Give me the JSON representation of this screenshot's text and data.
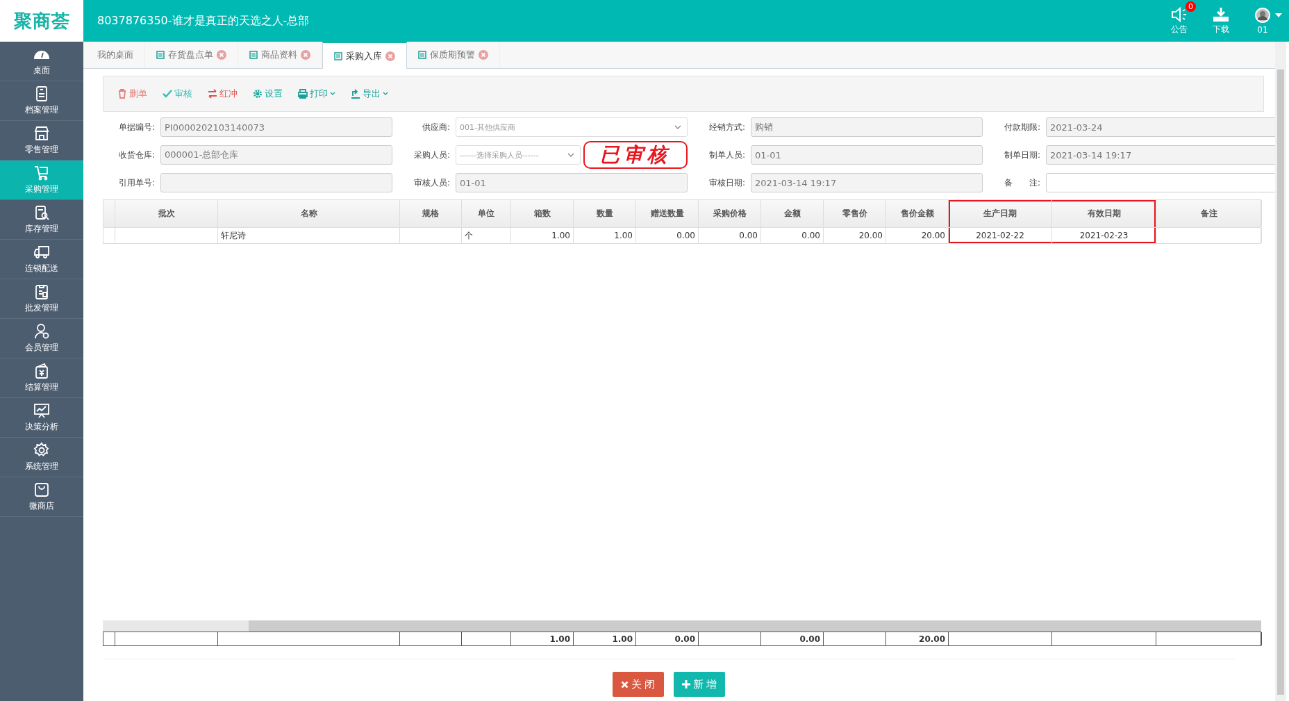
{
  "header": {
    "logo": "聚商荟",
    "title": "8037876350-谁才是真正的天选之人-总部",
    "notice": {
      "label": "公告",
      "badge": "0"
    },
    "download": {
      "label": "下载"
    },
    "user": {
      "label": "01"
    }
  },
  "sidebar": {
    "items": [
      {
        "label": "桌面",
        "kind": "gauge",
        "selected": false
      },
      {
        "label": "档案管理",
        "kind": "document",
        "selected": false
      },
      {
        "label": "零售管理",
        "kind": "store",
        "selected": false
      },
      {
        "label": "采购管理",
        "kind": "cart",
        "selected": true
      },
      {
        "label": "库存管理",
        "kind": "search",
        "selected": false
      },
      {
        "label": "连锁配送",
        "kind": "truck",
        "selected": false
      },
      {
        "label": "批发管理",
        "kind": "clipboard",
        "selected": false
      },
      {
        "label": "会员管理",
        "kind": "user",
        "selected": false
      },
      {
        "label": "结算管理",
        "kind": "wallet",
        "selected": false
      },
      {
        "label": "决策分析",
        "kind": "chart",
        "selected": false
      },
      {
        "label": "系统管理",
        "kind": "gear",
        "selected": false
      },
      {
        "label": "微商店",
        "kind": "bag",
        "selected": false
      }
    ]
  },
  "tabs": [
    {
      "label": "我的桌面",
      "closable": false,
      "selected": false
    },
    {
      "label": "存货盘点单",
      "closable": true,
      "selected": false
    },
    {
      "label": "商品资料",
      "closable": true,
      "selected": false
    },
    {
      "label": "采购入库",
      "closable": true,
      "selected": true
    },
    {
      "label": "保质期预警",
      "closable": true,
      "selected": false
    }
  ],
  "toolbar": [
    {
      "label": "删单",
      "kind": "delete",
      "dropdown": false
    },
    {
      "label": "审核",
      "kind": "approve",
      "dropdown": false
    },
    {
      "label": "红冲",
      "kind": "reverse",
      "dropdown": false
    },
    {
      "label": "设置",
      "kind": "settings",
      "dropdown": false
    },
    {
      "label": "打印",
      "kind": "print",
      "dropdown": true
    },
    {
      "label": "导出",
      "kind": "export",
      "dropdown": true
    }
  ],
  "form": [
    {
      "label": "单据编号:",
      "kind": "text",
      "value": "PI0000202103140073"
    },
    {
      "label": "供应商:",
      "kind": "select",
      "value": "001-其他供应商"
    },
    {
      "label": "经销方式:",
      "kind": "text",
      "value": "购销"
    },
    {
      "label": "付款期限:",
      "kind": "text",
      "value": "2021-03-24"
    },
    {
      "label": "收货仓库:",
      "kind": "text",
      "value": "000001-总部仓库"
    },
    {
      "label": "采购人员:",
      "kind": "select",
      "placeholder": "------选择采购人员------"
    },
    {
      "label": "制单人员:",
      "kind": "text",
      "value": "01-01"
    },
    {
      "label": "制单日期:",
      "kind": "text",
      "value": "2021-03-14 19:17"
    },
    {
      "label": "引用单号:",
      "kind": "text"
    },
    {
      "label": "审核人员:",
      "kind": "text",
      "value": "01-01"
    },
    {
      "label": "审核日期:",
      "kind": "text",
      "value": "2021-03-14 19:17"
    },
    {
      "label": "备　　注:",
      "kind": "text",
      "editable": true
    }
  ],
  "stamp": "已审核",
  "table": {
    "columns": [
      {
        "label": "批次",
        "highlighted": false
      },
      {
        "label": "名称",
        "highlighted": false
      },
      {
        "label": "规格",
        "highlighted": false
      },
      {
        "label": "单位",
        "highlighted": false
      },
      {
        "label": "箱数",
        "highlighted": false
      },
      {
        "label": "数量",
        "highlighted": false
      },
      {
        "label": "赠送数量",
        "highlighted": false
      },
      {
        "label": "采购价格",
        "highlighted": false
      },
      {
        "label": "金额",
        "highlighted": false
      },
      {
        "label": "零售价",
        "highlighted": false
      },
      {
        "label": "售价金额",
        "highlighted": false
      },
      {
        "label": "生产日期",
        "highlighted": true
      },
      {
        "label": "有效日期",
        "highlighted": true
      },
      {
        "label": "备注",
        "highlighted": false
      }
    ],
    "rows": [
      {
        "name": "轩尼诗",
        "unit": "个",
        "boxes": "1.00",
        "quantity": "1.00",
        "gift_quantity": "0.00",
        "purchase_price": "0.00",
        "amount": "0.00",
        "retail_price": "20.00",
        "retail_amount": "20.00",
        "production_date": "2021-02-22",
        "expiry_date": "2021-02-23"
      }
    ],
    "totals": {
      "boxes": "1.00",
      "quantity": "1.00",
      "gift_quantity": "0.00",
      "amount": "0.00",
      "retail_amount": "20.00"
    }
  },
  "buttons": [
    {
      "label": "关 闭",
      "kind": "close"
    },
    {
      "label": "新 增",
      "kind": "add"
    }
  ]
}
